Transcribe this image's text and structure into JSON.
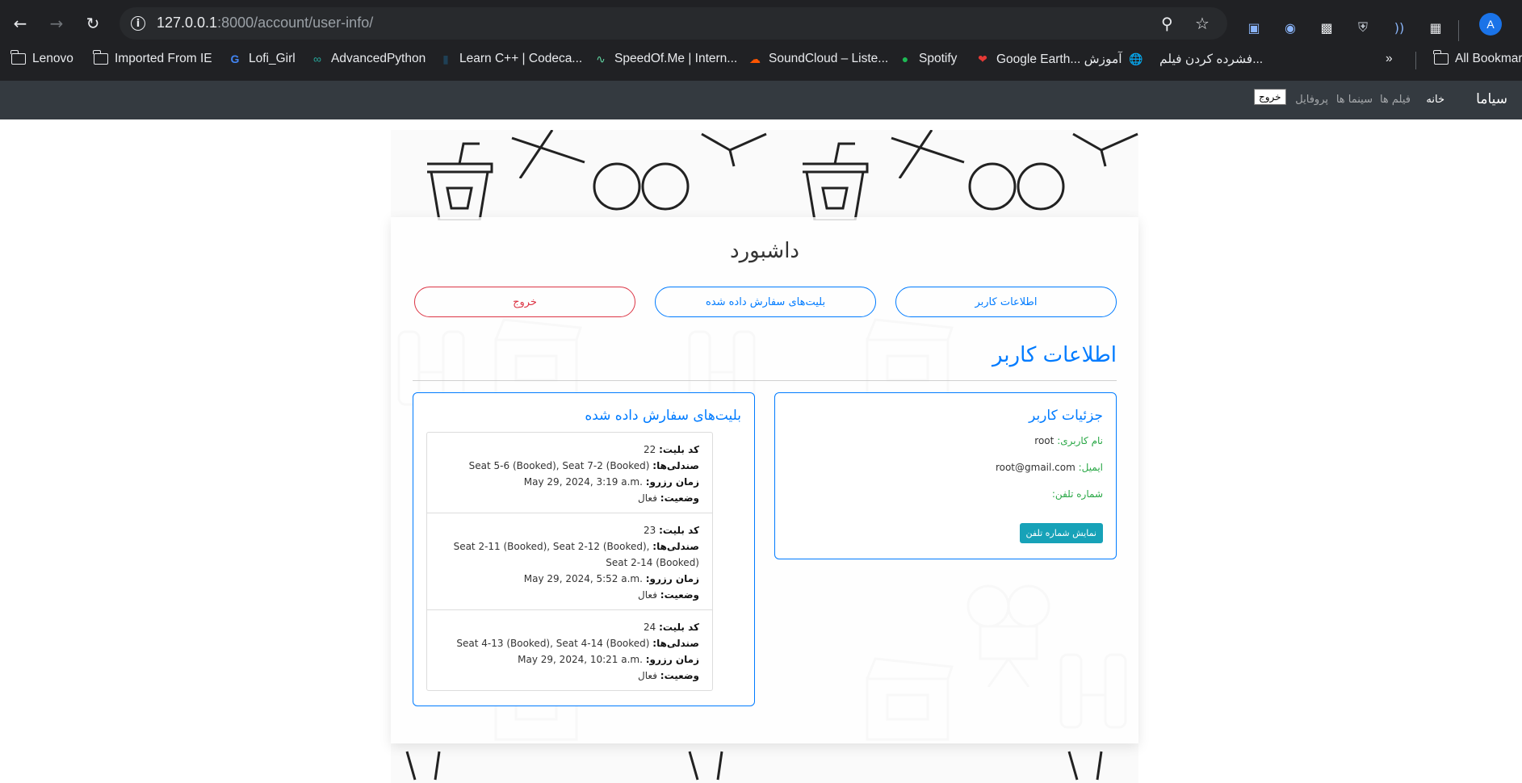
{
  "browser": {
    "url_host": "127.0.0.1",
    "url_path": ":8000/account/user-info/",
    "profile_initial": "A",
    "bookmarks": [
      {
        "label": "Lenovo"
      },
      {
        "label": "Imported From IE"
      },
      {
        "label": "Lofi_Girl"
      },
      {
        "label": "AdvancedPython"
      },
      {
        "label": "Learn C++ | Codeca..."
      },
      {
        "label": "SpeedOf.Me | Intern..."
      },
      {
        "label": "SoundCloud – Liste..."
      },
      {
        "label": "Spotify"
      },
      {
        "label": "Google Earth... آموزش"
      },
      {
        "label": "فشرده کردن فیلم..."
      },
      {
        "label": "All Bookmarks"
      }
    ]
  },
  "navbar": {
    "brand": "سیاما",
    "links": [
      "خانه",
      "فیلم ها",
      "سینما ها",
      "پروفایل"
    ],
    "logout": "خروج"
  },
  "dashboard": {
    "title": "داشبورد",
    "buttons": {
      "user_info": "اطلاعات کاربر",
      "tickets": "بلیت‌های سفارش داده شده",
      "logout": "خروج"
    },
    "section_title": "اطلاعات کاربر"
  },
  "user_details": {
    "title": "جزئیات کاربر",
    "username_label": "نام کاربری:",
    "username": "root",
    "email_label": "ایمیل:",
    "email": "root@gmail.com",
    "phone_label": "شماره تلفن:",
    "phone_button": "نمایش شماره تلفن"
  },
  "tickets": {
    "title": "بلیت‌های سفارش داده شده",
    "labels": {
      "code": "کد بلیت:",
      "seats": "صندلی‌ها:",
      "time": "زمان رزرو:",
      "status": "وضعیت:"
    },
    "items": [
      {
        "code": "22",
        "seats": "Seat 5-6 (Booked), Seat 7-2 (Booked)",
        "seats2": "",
        "time": "May 29, 2024, 3:19 a.m.",
        "status": "فعال"
      },
      {
        "code": "23",
        "seats": "Seat 2-11 (Booked), Seat 2-12 (Booked),",
        "seats2": "Seat 2-14 (Booked)",
        "time": "May 29, 2024, 5:52 a.m.",
        "status": "فعال"
      },
      {
        "code": "24",
        "seats": "Seat 4-13 (Booked), Seat 4-14 (Booked)",
        "seats2": "",
        "time": "May 29, 2024, 10:21 a.m.",
        "status": "فعال"
      }
    ]
  },
  "colors": {
    "primary": "#007bff",
    "danger": "#dc3545",
    "success": "#28a745",
    "info": "#17a2b8",
    "navbar": "#343a40"
  }
}
